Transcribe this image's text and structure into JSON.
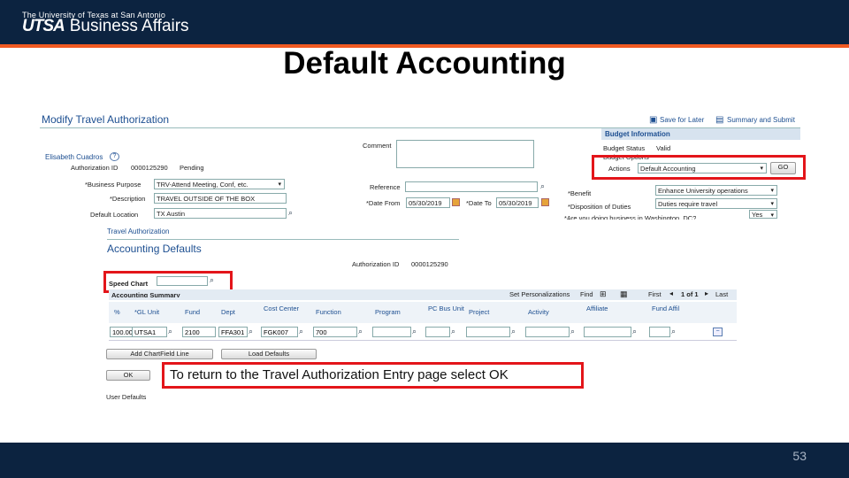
{
  "header": {
    "institution": "The University of Texas at San Antonio",
    "brand_bold": "UTSA",
    "brand_dept": "Business Affairs"
  },
  "slide": {
    "title": "Default Accounting",
    "page_number": "53",
    "callout": "To return to the Travel Authorization Entry page select OK"
  },
  "colors": {
    "navy": "#0c2340",
    "orange": "#f15a22",
    "highlight": "#e3151a"
  },
  "panel1": {
    "page_title": "Modify Travel Authorization",
    "save_for_later": "Save for Later",
    "summary_and_submit": "Summary and Submit",
    "employee_name": "Elisabeth Cuadros",
    "auth_id_label": "Authorization ID",
    "auth_id": "0000125290",
    "status": "Pending",
    "comment_label": "Comment",
    "business_purpose_label": "*Business Purpose",
    "business_purpose": "TRV-Attend Meeting, Conf, etc.",
    "description_label": "*Description",
    "description": "TRAVEL OUTSIDE OF THE BOX",
    "default_location_label": "Default Location",
    "default_location": "TX Austin",
    "reference_label": "Reference",
    "date_from_label": "*Date From",
    "date_from": "05/30/2019",
    "date_to_label": "*Date To",
    "date_to": "05/30/2019",
    "budget_info_title": "Budget Information",
    "budget_status_label": "Budget Status",
    "budget_status": "Valid",
    "budget_options_label": "Budget Options",
    "actions_label": "Actions",
    "actions_value": "Default Accounting",
    "go_button": "GO",
    "benefit_label": "*Benefit",
    "benefit": "Enhance University operations",
    "disposition_label": "*Disposition of Duties",
    "disposition": "Duties require travel",
    "washington_label": "*Are you doing business in Washington, DC?",
    "washington": "Yes"
  },
  "panel2": {
    "section": "Travel Authorization",
    "title": "Accounting Defaults",
    "auth_id_label": "Authorization ID",
    "auth_id": "0000125290",
    "speed_chart_label": "Speed Chart",
    "accounting_summary": "Accounting Summary",
    "grid_nav": {
      "personalize": "Set Personalizations",
      "find": "Find",
      "first": "First",
      "count": "1 of 1",
      "last": "Last"
    },
    "columns": [
      "%",
      "*GL Unit",
      "Fund",
      "Dept",
      "Cost Center",
      "Function",
      "Program",
      "PC Bus Unit",
      "Project",
      "Activity",
      "Affiliate",
      "Fund Affil"
    ],
    "row": [
      "100.00",
      "UTSA1",
      "2100",
      "FFA301",
      "FGK007",
      "700",
      "",
      "",
      "",
      "",
      "",
      ""
    ],
    "add_chartfield": "Add ChartField Line",
    "load_defaults": "Load Defaults",
    "ok_button": "OK",
    "user_defaults": "User Defaults"
  }
}
